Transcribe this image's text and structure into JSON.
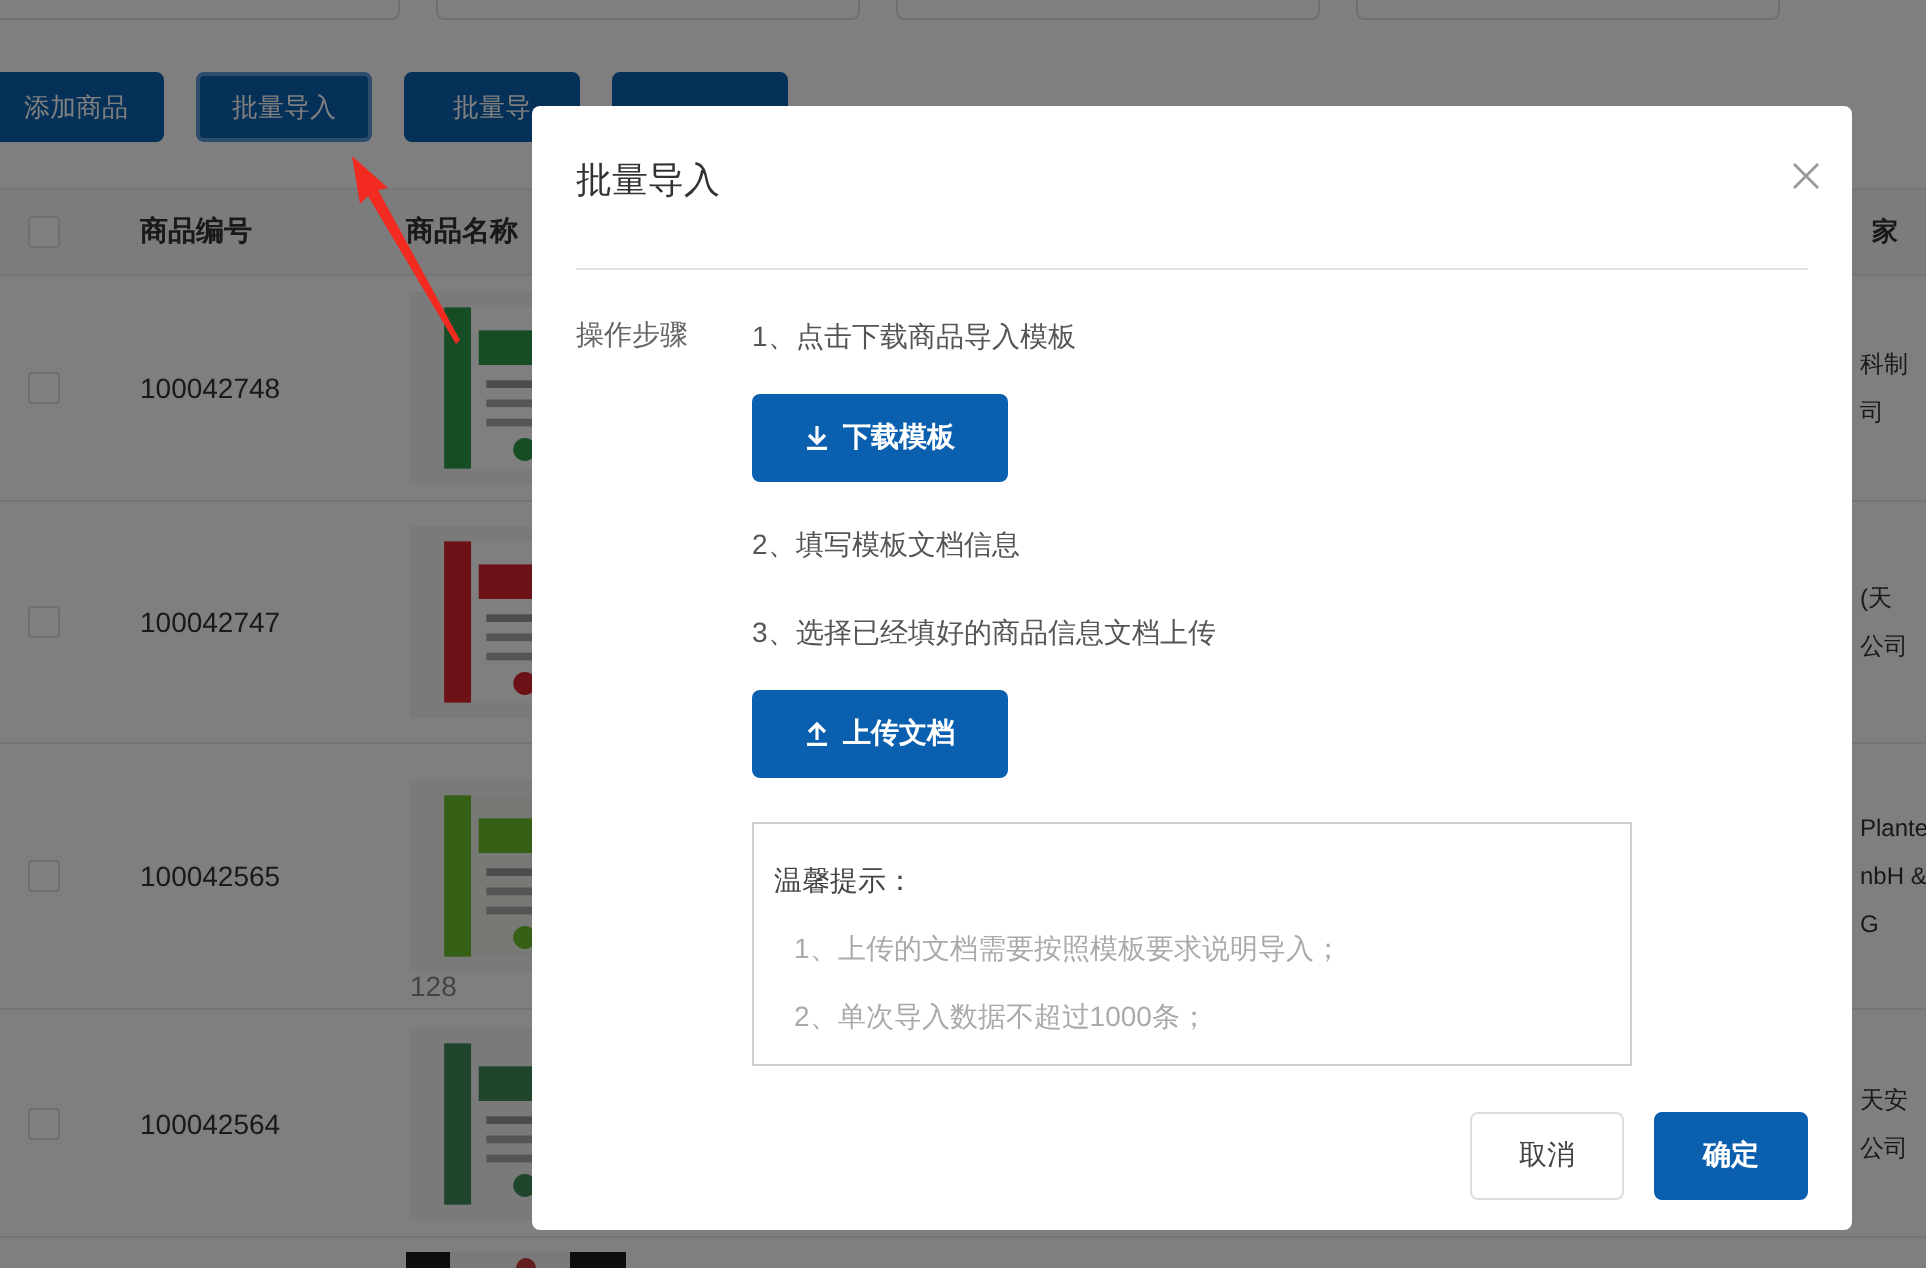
{
  "toolbar": [
    {
      "label": "添加商品",
      "focused": false
    },
    {
      "label": "批量导入",
      "focused": true
    },
    {
      "label": "批量导",
      "focused": false
    },
    {
      "focused": false
    }
  ],
  "table": {
    "columns": [
      "商品编号",
      "商品名称",
      "家"
    ],
    "all_checked": false,
    "rows": [
      {
        "checked": false,
        "id": "100042748",
        "manufacturer": [
          "科制",
          "司"
        ]
      },
      {
        "checked": false,
        "id": "100042747",
        "manufacturer": [
          "(天",
          "公司"
        ]
      },
      {
        "checked": false,
        "id": "100042565",
        "note": "128",
        "manufacturer": [
          "Plante",
          "nbH &",
          "G"
        ]
      },
      {
        "checked": false,
        "id": "100042564",
        "manufacturer": [
          "天安",
          "公司"
        ]
      },
      {
        "kind": "picture"
      }
    ]
  },
  "dialog": {
    "title": "批量导入",
    "steps_label": "操作步骤",
    "steps": [
      {
        "kind": "text",
        "text": "1、点击下载商品导入模板"
      },
      {
        "kind": "download",
        "label": "下载模板"
      },
      {
        "kind": "text",
        "text": "2、填写模板文档信息"
      },
      {
        "kind": "text",
        "text": "3、选择已经填好的商品信息文档上传"
      },
      {
        "kind": "upload",
        "label": "上传文档"
      }
    ],
    "tips": {
      "title": "温馨提示：",
      "items": [
        "1、上传的文档需要按照模板要求说明导入；",
        "2、单次导入数据不超过1000条；"
      ]
    },
    "buttons": [
      {
        "label": "取消",
        "primary": false
      },
      {
        "label": "确定",
        "primary": true
      }
    ]
  }
}
